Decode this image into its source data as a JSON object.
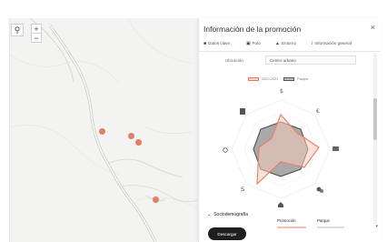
{
  "panel": {
    "title": "Información de la promoción",
    "close_glyph": "×",
    "tabs": [
      {
        "icon": "datasheet-icon",
        "label": "Datos clave"
      },
      {
        "icon": "photo-icon",
        "label": "Foto"
      },
      {
        "icon": "surroundings-icon",
        "label": "Entorno"
      },
      {
        "icon": "info-icon",
        "label": "Información general"
      }
    ],
    "location": {
      "label": "Ubicación",
      "value": "Centro urbano"
    },
    "legend": {
      "promotion": "2020-2021",
      "park": "Parque"
    },
    "section_title": "Sociodemografía",
    "columns": {
      "promotion": "Promoción",
      "park": "Parque"
    },
    "download_label": "Descargar"
  },
  "map": {
    "search_glyph": "⚲",
    "zoom_in": "+",
    "zoom_out": "−",
    "marker_color": "#e07f62",
    "markers": 4
  },
  "colors": {
    "promotion_stroke": "#e57e61",
    "promotion_fill": "#f7d4c9",
    "park_stroke": "#444444",
    "park_fill": "#9a9a9a"
  },
  "radar_icons": [
    "money-icon",
    "euro-icon",
    "id-card-icon",
    "group-icon",
    "home-icon",
    "dollar-icon",
    "light-bulb-icon",
    "building-icon"
  ]
}
